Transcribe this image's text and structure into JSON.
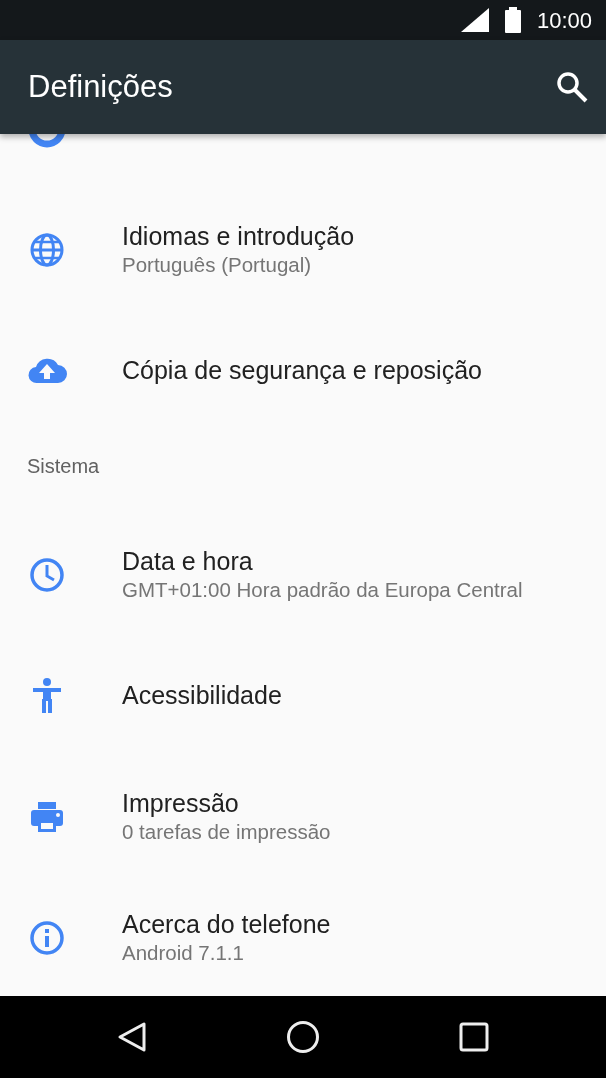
{
  "status_bar": {
    "time": "10:00"
  },
  "app_bar": {
    "title": "Definições"
  },
  "rows": [
    {
      "kind": "item"
    },
    {
      "kind": "item",
      "title": "Idiomas e introdução",
      "subtitle": "Português (Portugal)"
    },
    {
      "kind": "item",
      "title": "Cópia de segurança e reposição"
    },
    {
      "kind": "header",
      "title": "Sistema"
    },
    {
      "kind": "item",
      "title": "Data e hora",
      "subtitle": "GMT+01:00 Hora padrão da Europa Central"
    },
    {
      "kind": "item",
      "title": "Acessibilidade"
    },
    {
      "kind": "item",
      "title": "Impressão",
      "subtitle": "0 tarefas de impressão"
    },
    {
      "kind": "item",
      "title": "Acerca do telefone",
      "subtitle": "Android 7.1.1"
    }
  ]
}
